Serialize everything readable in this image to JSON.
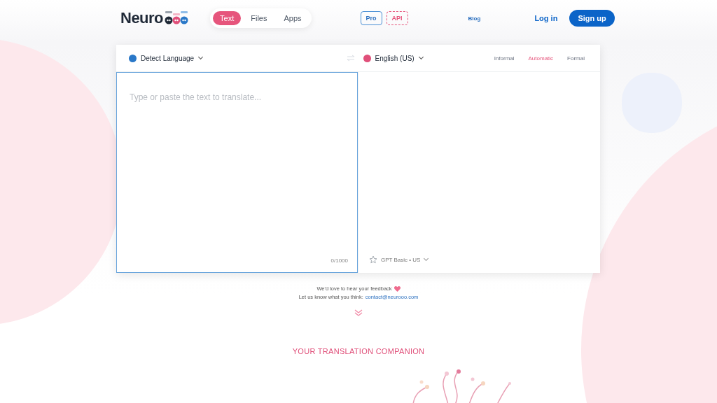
{
  "header": {
    "logo": "Neuro",
    "modes": [
      {
        "label": "Text",
        "selected": true
      },
      {
        "label": "Files",
        "selected": false
      },
      {
        "label": "Apps",
        "selected": false
      }
    ],
    "pro": "Pro",
    "api": "API",
    "blog": "Blog",
    "login": "Log in",
    "signup": "Sign up"
  },
  "translator": {
    "source_language": "Detect Language",
    "target_language": "English (US)",
    "tones": [
      {
        "label": "Informal",
        "selected": false
      },
      {
        "label": "Automatic",
        "selected": true
      },
      {
        "label": "Formal",
        "selected": false
      }
    ],
    "placeholder": "Type or paste the text to translate...",
    "counter": "0/1000",
    "model": "GPT Basic • US"
  },
  "feedback": {
    "line": "We'd love to hear your feedback",
    "prompt": "Let us know what you think:",
    "email": "contact@neurooo.com"
  },
  "section_title": "YOUR TRANSLATION COMPANION"
}
